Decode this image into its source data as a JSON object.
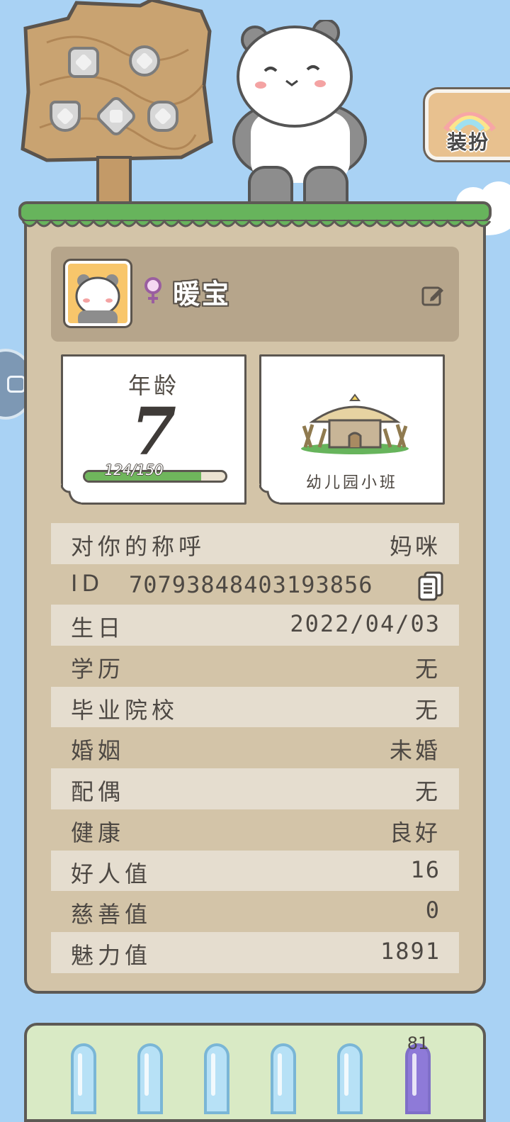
{
  "top": {
    "dress_label": "装扮"
  },
  "profile": {
    "gender_symbol": "♀",
    "nickname": "暖宝"
  },
  "age_card": {
    "title": "年龄",
    "age": "7",
    "progress_text": "124/150",
    "progress_value": 124,
    "progress_max": 150
  },
  "school_card": {
    "name": "幼儿园小班"
  },
  "info": {
    "address": {
      "label": "对你的称呼",
      "value": "妈咪"
    },
    "id": {
      "label": "ID",
      "value": "70793848403193856"
    },
    "birthday": {
      "label": "生日",
      "value": "2022/04/03"
    },
    "education": {
      "label": "学历",
      "value": "无"
    },
    "school": {
      "label": "毕业院校",
      "value": "无"
    },
    "marriage": {
      "label": "婚姻",
      "value": "未婚"
    },
    "spouse": {
      "label": "配偶",
      "value": "无"
    },
    "health": {
      "label": "健康",
      "value": "良好"
    },
    "kindness": {
      "label": "好人值",
      "value": "16"
    },
    "charity": {
      "label": "慈善值",
      "value": "0"
    },
    "charm": {
      "label": "魅力值",
      "value": "1891"
    }
  },
  "bottom": {
    "tube_label": "81"
  },
  "colors": {
    "background": "#a9d2f4",
    "panel": "#d3c4a8",
    "row_shade": "#e5ddcf",
    "progress_fill": "#6fb65c",
    "grass": "#67b45c"
  }
}
